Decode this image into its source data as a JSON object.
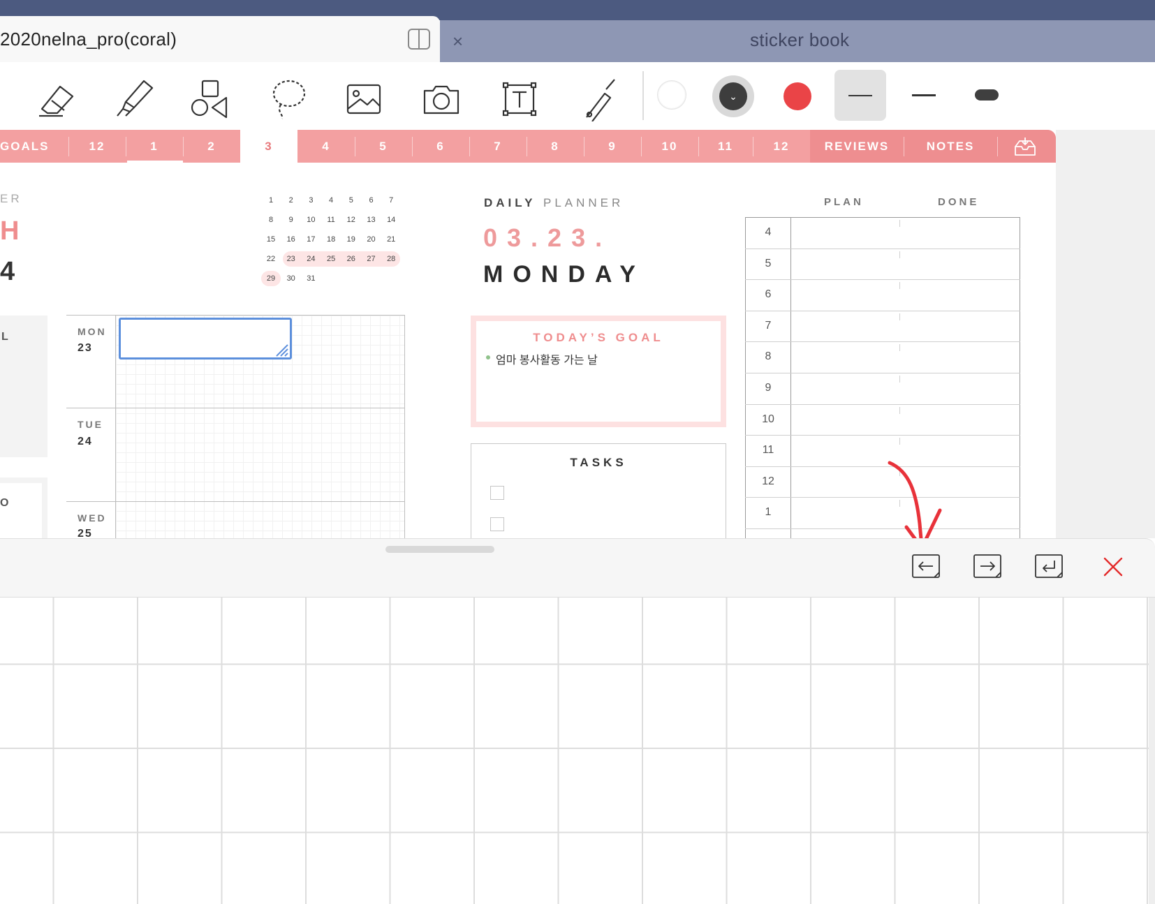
{
  "tabs": {
    "active_title": "2020nelna_pro(coral)",
    "inactive_title": "sticker book",
    "close_glyph": "×"
  },
  "toolbar": {
    "tools": [
      "eraser-icon",
      "highlighter-icon",
      "shapes-icon",
      "lasso-icon",
      "image-icon",
      "camera-icon",
      "textbox-icon",
      "laser-pointer-icon"
    ],
    "colors": {
      "white": "#ffffff",
      "dark": "#3d3d3d",
      "red": "#ea4447"
    },
    "selected_stroke": "thin"
  },
  "month_nav": {
    "goals": "GOALS",
    "months": [
      "12",
      "1",
      "2",
      "3",
      "4",
      "5",
      "6",
      "7",
      "8",
      "9",
      "10",
      "11",
      "12"
    ],
    "active_month": "3",
    "reviews": "REVIEWS",
    "notes": "NOTES",
    "accent": "#f3a0a1"
  },
  "left_page": {
    "cut_er": "ER",
    "cut_h": "H",
    "cut_4": "4",
    "cut_l": "L",
    "cut_o": "O",
    "mini_calendar": [
      [
        "1",
        "2",
        "3",
        "4",
        "5",
        "6",
        "7"
      ],
      [
        "8",
        "9",
        "10",
        "11",
        "12",
        "13",
        "14"
      ],
      [
        "15",
        "16",
        "17",
        "18",
        "19",
        "20",
        "21"
      ],
      [
        "22",
        "23",
        "24",
        "25",
        "26",
        "27",
        "28"
      ],
      [
        "29",
        "30",
        "31"
      ]
    ],
    "week": [
      {
        "day": "MON",
        "date": "23"
      },
      {
        "day": "TUE",
        "date": "24"
      },
      {
        "day": "WED",
        "date": "25"
      }
    ]
  },
  "daily": {
    "daily_label": "DAILY",
    "planner_label": "PLANNER",
    "date": "03.23.",
    "weekday": "MONDAY",
    "goal_title": "TODAY’S GOAL",
    "goal_item": "엄마 봉사활동 가는 날",
    "tasks_title": "TASKS"
  },
  "timetable": {
    "plan_label": "PLAN",
    "done_label": "DONE",
    "hours": [
      "4",
      "5",
      "6",
      "7",
      "8",
      "9",
      "10",
      "11",
      "12",
      "1"
    ]
  },
  "keyboard_bar": {
    "buttons": [
      "undo-arrow-left-icon",
      "redo-arrow-right-icon",
      "return-icon",
      "close-icon"
    ]
  }
}
